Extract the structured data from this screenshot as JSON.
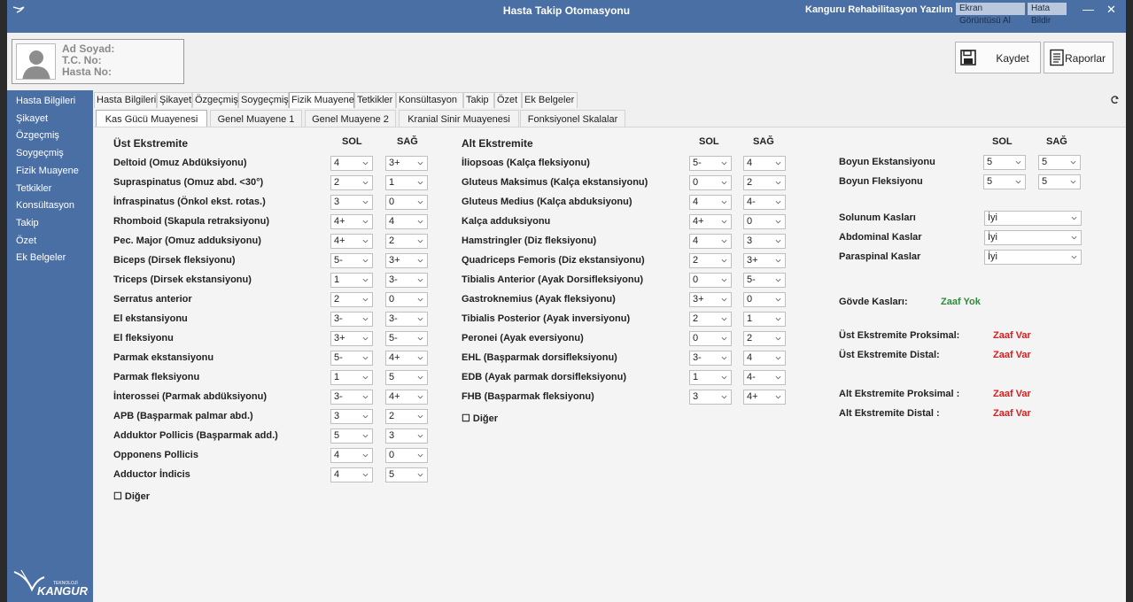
{
  "window": {
    "title": "Hasta Takip Otomasyonu",
    "company": "Kanguru Rehabilitasyon Yazılım Ltd. Şti.",
    "screenshot_button": "Ekran Görüntüsü Al",
    "report_bug_button": "Hata Bildir",
    "minimize": "—",
    "close": "✕"
  },
  "patient": {
    "name_label": "Ad Soyad:",
    "tc_label": "T.C. No:",
    "number_label": "Hasta No:"
  },
  "actions": {
    "save": "Kaydet",
    "reports": "Raporlar"
  },
  "sidebar": {
    "items": [
      "Hasta Bilgileri",
      "Şikayet",
      "Özgeçmiş",
      "Soygeçmiş",
      "Fizik Muayene",
      "Tetkikler",
      "Konsültasyon",
      "Takip",
      "Özet",
      "Ek Belgeler"
    ],
    "logo_text": "KANGURU",
    "logo_small": "TEKNOLOJİ"
  },
  "main_tabs": [
    "Hasta Bilgileri",
    "Şikayet",
    "Özgeçmiş",
    "Soygeçmiş",
    "Fizik Muayene",
    "Tetkikler",
    "Konsültasyon",
    "Takip",
    "Özet",
    "Ek Belgeler"
  ],
  "sub_tabs": [
    "Kas Gücü Muayenesi",
    "Genel Muayene 1",
    "Genel Muayene 2",
    "Kranial Sinir Muayenesi",
    "Fonksiyonel Skalalar"
  ],
  "columns": {
    "left": "SOL",
    "right": "SAĞ"
  },
  "upper": {
    "title": "Üst Ekstremite",
    "rows": [
      {
        "label": "Deltoid (Omuz Abdüksiyonu)",
        "sol": "4",
        "sag": "3+"
      },
      {
        "label": "Supraspinatus (Omuz abd. <30°)",
        "sol": "2",
        "sag": "1"
      },
      {
        "label": "İnfraspinatus (Önkol ekst. rotas.)",
        "sol": "3",
        "sag": "0"
      },
      {
        "label": "Rhomboid (Skapula retraksiyonu)",
        "sol": "4+",
        "sag": "4"
      },
      {
        "label": "Pec. Major (Omuz adduksiyonu)",
        "sol": "4+",
        "sag": "2"
      },
      {
        "label": "Biceps (Dirsek fleksiyonu)",
        "sol": "5-",
        "sag": "3+"
      },
      {
        "label": "Triceps (Dirsek ekstansiyonu)",
        "sol": "1",
        "sag": "3-"
      },
      {
        "label": "Serratus anterior",
        "sol": "2",
        "sag": "0"
      },
      {
        "label": "El ekstansiyonu",
        "sol": "3-",
        "sag": "3-"
      },
      {
        "label": "El fleksiyonu",
        "sol": "3+",
        "sag": "5-"
      },
      {
        "label": "Parmak ekstansiyonu",
        "sol": "5-",
        "sag": "4+"
      },
      {
        "label": "Parmak fleksiyonu",
        "sol": "1",
        "sag": "5"
      },
      {
        "label": "İnterossei (Parmak abdüksiyonu)",
        "sol": "3-",
        "sag": "4+"
      },
      {
        "label": "APB (Başparmak palmar abd.)",
        "sol": "3",
        "sag": "2"
      },
      {
        "label": "Adduktor Pollicis (Başparmak add.)",
        "sol": "5",
        "sag": "3"
      },
      {
        "label": "Opponens Pollicis",
        "sol": "4",
        "sag": "0"
      },
      {
        "label": "Adductor İndicis",
        "sol": "4",
        "sag": "5"
      }
    ],
    "other": "☐ Diğer"
  },
  "lower": {
    "title": "Alt Ekstremite",
    "rows": [
      {
        "label": "İliopsoas (Kalça fleksiyonu)",
        "sol": "5-",
        "sag": "4"
      },
      {
        "label": "Gluteus Maksimus (Kalça ekstansiyonu)",
        "sol": "0",
        "sag": "2"
      },
      {
        "label": "Gluteus Medius (Kalça abduksiyonu)",
        "sol": "4",
        "sag": "4-"
      },
      {
        "label": "Kalça adduksiyonu",
        "sol": "4+",
        "sag": "0"
      },
      {
        "label": "Hamstringler (Diz fleksiyonu)",
        "sol": "4",
        "sag": "3"
      },
      {
        "label": "Quadriceps Femoris (Diz ekstansiyonu)",
        "sol": "2",
        "sag": "3+"
      },
      {
        "label": "Tibialis Anterior (Ayak Dorsifleksiyonu)",
        "sol": "0",
        "sag": "5-"
      },
      {
        "label": "Gastroknemius (Ayak fleksiyonu)",
        "sol": "3+",
        "sag": "0"
      },
      {
        "label": "Tibialis Posterior (Ayak inversiyonu)",
        "sol": "2",
        "sag": "1"
      },
      {
        "label": "Peronei (Ayak eversiyonu)",
        "sol": "0",
        "sag": "2"
      },
      {
        "label": "EHL (Başparmak dorsifleksiyonu)",
        "sol": "3-",
        "sag": "4"
      },
      {
        "label": "EDB (Ayak parmak dorsifleksiyonu)",
        "sol": "1",
        "sag": "4-"
      },
      {
        "label": "FHB (Başparmak fleksiyonu)",
        "sol": "3",
        "sag": "4+"
      }
    ],
    "other": "☐ Diğer"
  },
  "neck": {
    "rows": [
      {
        "label": "Boyun Ekstansiyonu",
        "sol": "5",
        "sag": "5"
      },
      {
        "label": "Boyun Fleksiyonu",
        "sol": "5",
        "sag": "5"
      }
    ]
  },
  "trunk": {
    "rows": [
      {
        "label": "Solunum Kasları",
        "value": "İyi"
      },
      {
        "label": "Abdominal Kaslar",
        "value": "İyi"
      },
      {
        "label": "Paraspinal Kaslar",
        "value": "İyi"
      }
    ]
  },
  "status": {
    "rows": [
      {
        "label": "Gövde Kasları:",
        "value": "Zaaf Yok",
        "ok": true
      },
      {
        "label": "Üst Ekstremite Proksimal:",
        "value": "Zaaf Var",
        "ok": false
      },
      {
        "label": "Üst Ekstremite Distal:",
        "value": "Zaaf Var",
        "ok": false
      },
      {
        "label": "Alt Ekstremite Proksimal :",
        "value": "Zaaf Var",
        "ok": false
      },
      {
        "label": "Alt Ekstremite Distal :",
        "value": "Zaaf Var",
        "ok": false
      }
    ]
  },
  "colors": {
    "brand": "#4a6fa5",
    "ok": "#2e8b3a",
    "bad": "#d81e1e"
  }
}
